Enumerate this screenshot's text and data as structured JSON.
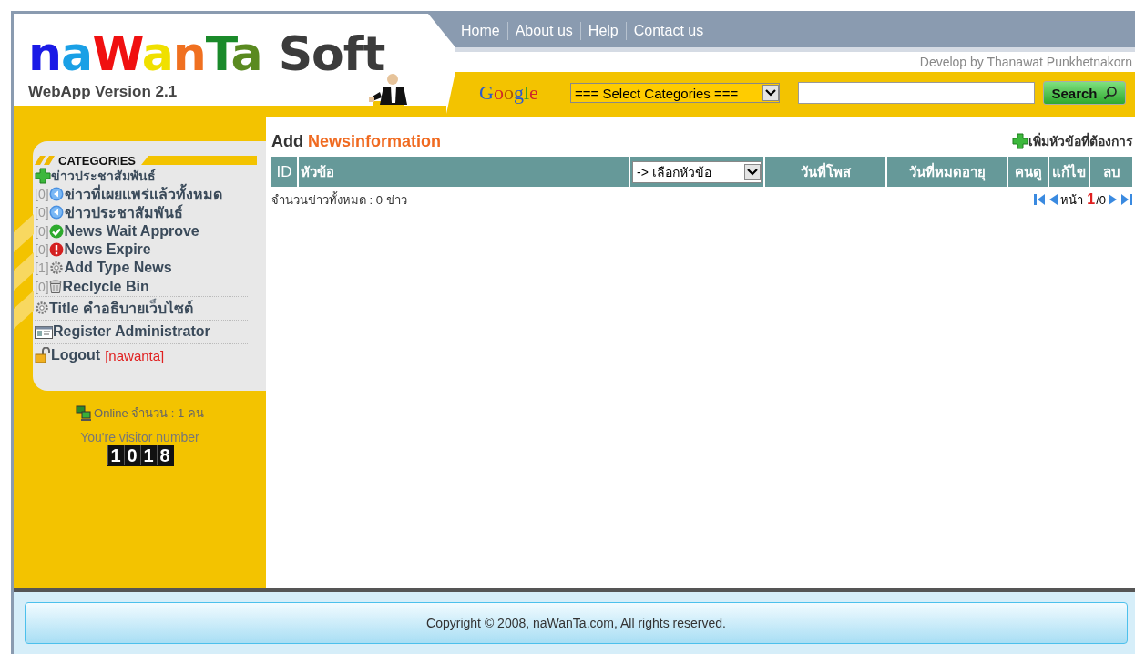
{
  "header": {
    "logo": {
      "letters": [
        {
          "text": "n",
          "color": "#1a1ae6"
        },
        {
          "text": "a",
          "color": "#1aa0e6"
        },
        {
          "text": "W",
          "color": "#f01010"
        },
        {
          "text": "a",
          "color": "#f0e000"
        },
        {
          "text": "n",
          "color": "#f07020"
        },
        {
          "text": "T",
          "color": "#1a8a2a"
        },
        {
          "text": "a",
          "color": "#5a8a20"
        }
      ],
      "word": "Soft",
      "tagline": "WebApp Version 2.1"
    },
    "nav": [
      "Home",
      "About us",
      "Help",
      "Contact us"
    ],
    "credit": "Develop by Thanawat Punkhetnakorn",
    "search": {
      "provider": "Google",
      "category_select": "=== Select Categories ===",
      "button": "Search"
    }
  },
  "sidebar": {
    "heading": "CATEGORIES",
    "root": "ข่าวประชาสัมพันธ์",
    "categories": [
      {
        "count": "[0]",
        "kind": "back",
        "label": "ข่าวที่เผยแพร่แล้วทั้งหมด"
      },
      {
        "count": "[0]",
        "kind": "back",
        "label": "ข่าวประชาสัมพันธ์"
      },
      {
        "count": "[0]",
        "kind": "check",
        "label": "News Wait Approve"
      },
      {
        "count": "[0]",
        "kind": "alert",
        "label": "News Expire"
      },
      {
        "count": "[1]",
        "kind": "gear",
        "label": "Add Type News"
      },
      {
        "count": "[0]",
        "kind": "bin",
        "label": "Reclycle Bin"
      }
    ],
    "links": [
      {
        "kind": "gear",
        "label": "Title คำอธิบายเว็บไซต์"
      },
      {
        "kind": "card",
        "label": "Register Administrator"
      },
      {
        "kind": "lock",
        "label": "Logout",
        "user": "[nawanta]"
      }
    ],
    "online": "Online จำนวน : 1 คน",
    "visitor_label": "You're visitor number",
    "visitor_digits": [
      "1",
      "0",
      "1",
      "8"
    ]
  },
  "content": {
    "title_prefix": "Add",
    "title": "Newsinformation",
    "add_link": "เพิ่มหัวข้อที่ต้องการ",
    "table": {
      "columns": [
        {
          "kind": "text",
          "label": "ID"
        },
        {
          "kind": "text",
          "label": "หัวข้อ"
        },
        {
          "kind": "select",
          "label": "-> เลือกหัวข้อ"
        },
        {
          "kind": "text",
          "label": "วันที่โพส"
        },
        {
          "kind": "text",
          "label": "วันที่หมดอายุ"
        },
        {
          "kind": "text",
          "label": "คนดู"
        },
        {
          "kind": "text",
          "label": "แก้ไข"
        },
        {
          "kind": "text",
          "label": "ลบ"
        }
      ]
    },
    "total": "จำนวนข่าวทั้งหมด : 0 ข่าว",
    "pager": {
      "label": "หน้า",
      "current": "1",
      "total": "/0"
    }
  },
  "footer": "Copyright © 2008, naWanTa.com, All rights reserved."
}
